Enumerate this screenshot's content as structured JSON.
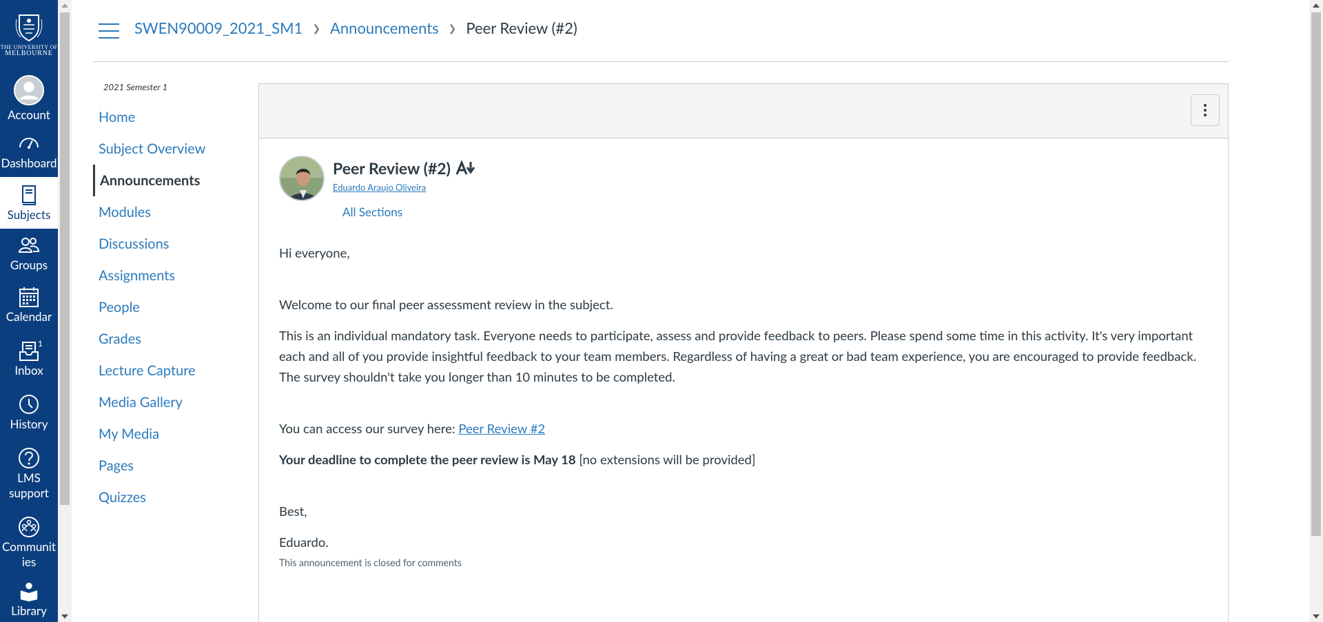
{
  "global_nav": {
    "logo_line1": "THE UNIVERSITY OF",
    "logo_line2": "MELBOURNE",
    "items": [
      {
        "label": "Account",
        "icon": "account-icon"
      },
      {
        "label": "Dashboard",
        "icon": "dashboard-icon"
      },
      {
        "label": "Subjects",
        "icon": "subjects-icon"
      },
      {
        "label": "Groups",
        "icon": "groups-icon"
      },
      {
        "label": "Calendar",
        "icon": "calendar-icon"
      },
      {
        "label": "Inbox",
        "icon": "inbox-icon",
        "badge": "1"
      },
      {
        "label": "History",
        "icon": "history-icon"
      },
      {
        "label": "LMS support",
        "icon": "help-icon"
      },
      {
        "label": "Communities",
        "icon": "communities-icon"
      },
      {
        "label": "Library",
        "icon": "library-icon"
      }
    ]
  },
  "breadcrumb": {
    "course": "SWEN90009_2021_SM1",
    "section": "Announcements",
    "current": "Peer Review (#2)"
  },
  "course_nav": {
    "term": "2021 Semester 1",
    "items": [
      "Home",
      "Subject Overview",
      "Announcements",
      "Modules",
      "Discussions",
      "Assignments",
      "People",
      "Grades",
      "Lecture Capture",
      "Media Gallery",
      "My Media",
      "Pages",
      "Quizzes"
    ],
    "active": "Announcements"
  },
  "post": {
    "title": "Peer Review (#2)",
    "author": "Eduardo Araujo Oliveira",
    "sections": "All Sections",
    "greeting": "Hi everyone,",
    "p1": "Welcome to our final peer assessment review in the subject.",
    "p2": "This is an individual mandatory task. Everyone needs to participate, assess and provide feedback to peers. Please spend some time in this activity. It's very important each and all of you provide insightful feedback to your team members. Regardless of having a great or bad team experience, you are encouraged to provide feedback. The survey shouldn't take you longer than 10 minutes to be completed.",
    "survey_prefix": "You can access our survey here: ",
    "survey_link": "Peer Review #2",
    "deadline_bold": "Your deadline to complete the peer review is May 18",
    "deadline_rest": " [no extensions will be provided]",
    "closing": "Best,",
    "signature": "Eduardo.",
    "closed_note": "This announcement is closed for comments"
  },
  "colors": {
    "nav_bg": "#0b3e7e",
    "link": "#2b7abc",
    "text": "#2d3b45"
  }
}
